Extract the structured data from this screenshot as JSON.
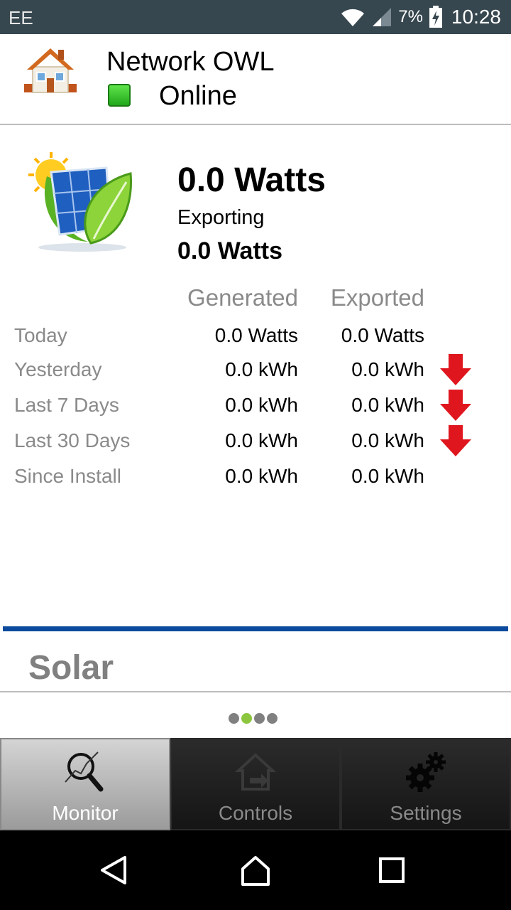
{
  "status_bar": {
    "carrier": "EE",
    "battery": "7%",
    "time": "10:28"
  },
  "header": {
    "device_name": "Network OWL",
    "status": "Online",
    "status_color": "#2ec41e"
  },
  "solar": {
    "generating": "0.0 Watts",
    "exporting_label": "Exporting",
    "exporting": "0.0 Watts"
  },
  "table": {
    "columns": [
      "Generated",
      "Exported"
    ],
    "rows": [
      {
        "label": "Today",
        "generated": "0.0 Watts",
        "exported": "0.0 Watts",
        "arrow": false
      },
      {
        "label": "Yesterday",
        "generated": "0.0 kWh",
        "exported": "0.0 kWh",
        "arrow": true
      },
      {
        "label": "Last 7 Days",
        "generated": "0.0 kWh",
        "exported": "0.0 kWh",
        "arrow": true
      },
      {
        "label": "Last 30 Days",
        "generated": "0.0 kWh",
        "exported": "0.0 kWh",
        "arrow": true
      },
      {
        "label": "Since Install",
        "generated": "0.0 kWh",
        "exported": "0.0 kWh",
        "arrow": false
      }
    ],
    "arrow_icon": "down-arrow-icon",
    "arrow_color": "#e0161e"
  },
  "page": {
    "label": "Solar",
    "indicator_count": 4,
    "indicator_active": 2,
    "accent": "#0b4a9c"
  },
  "tabs": [
    {
      "label": "Monitor",
      "icon": "magnifier-icon",
      "selected": true
    },
    {
      "label": "Controls",
      "icon": "house-controls-icon",
      "selected": false
    },
    {
      "label": "Settings",
      "icon": "gears-icon",
      "selected": false
    }
  ],
  "nav": {
    "back": "back-icon",
    "home": "home-icon",
    "recents": "recents-icon"
  }
}
